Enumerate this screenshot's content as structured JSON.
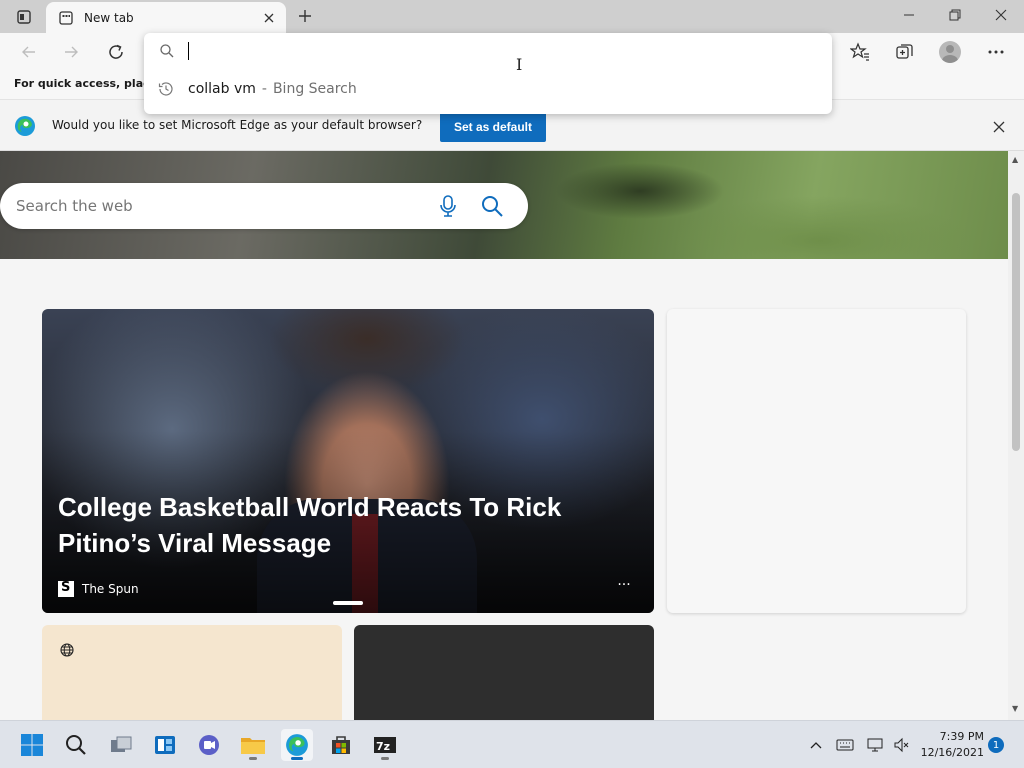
{
  "browser": {
    "tab_title": "New tab",
    "favorites_hint": "For quick access, place y"
  },
  "omnibox": {
    "value": "",
    "suggestion": {
      "main": "collab vm",
      "separator": "-",
      "sub": "Bing Search"
    }
  },
  "infobar": {
    "message": "Would you like to set Microsoft Edge as your default browser?",
    "button_label": "Set as default"
  },
  "ntp": {
    "search_placeholder": "Search the web",
    "headline": "College Basketball World Reacts To Rick Pitino’s Viral Message",
    "source": "The Spun",
    "more": "···"
  },
  "taskbar": {
    "time": "7:39 PM",
    "date": "12/16/2021",
    "notification_count": "1",
    "icons": [
      "windows-start-icon",
      "search-icon",
      "task-view-icon",
      "widgets-icon",
      "teams-chat-icon",
      "file-explorer-icon",
      "edge-icon",
      "store-icon",
      "7zip-icon"
    ]
  },
  "colors": {
    "accent": "#0f6cbd",
    "titlebar": "#cfcfcf",
    "taskbar": "#dfe3ea"
  }
}
